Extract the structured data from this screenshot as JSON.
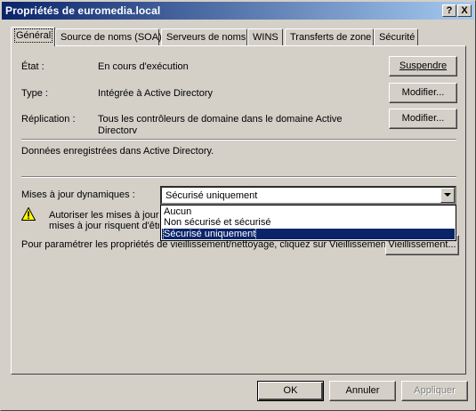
{
  "window": {
    "title": "Propriétés de euromedia.local",
    "help_button": "?",
    "close_button": "X"
  },
  "tabs": [
    {
      "label": "Général",
      "active": true
    },
    {
      "label": "Source de noms (SOA)"
    },
    {
      "label": "Serveurs de noms"
    },
    {
      "label": "WINS"
    },
    {
      "label": "Transferts de zone"
    },
    {
      "label": "Sécurité"
    }
  ],
  "general": {
    "state_label": "État :",
    "state_value": "En cours d'exécution",
    "suspend_button": "Suspendre",
    "type_label": "Type :",
    "type_value": "Intégrée à Active Directory",
    "type_modify_button": "Modifier...",
    "replication_label": "Réplication :",
    "replication_value_line1": "Tous les contrôleurs de domaine dans le domaine Active",
    "replication_value_line2": "Directory",
    "replication_modify_button": "Modifier...",
    "data_stored_text": "Données enregistrées dans Active Directory.",
    "dynamic_updates_label": "Mises à jour dynamiques :",
    "dynamic_updates_selected": "Sécurisé uniquement",
    "dynamic_updates_options": [
      "Aucun",
      "Non sécurisé et sécurisé",
      "Sécurisé uniquement"
    ],
    "warning_line1": "Autoriser les mises à jour dynamiques non sécurisées est une faille de sécurité importante, car les",
    "warning_line2": "mises à jour risquent d'être",
    "aging_text": "Pour paramétrer les propriétés de vieillissement/nettoyage, cliquez sur Vieillissement.",
    "aging_button": "Vieillissement..."
  },
  "footer": {
    "ok_button": "OK",
    "cancel_button": "Annuler",
    "apply_button": "Appliquer"
  }
}
